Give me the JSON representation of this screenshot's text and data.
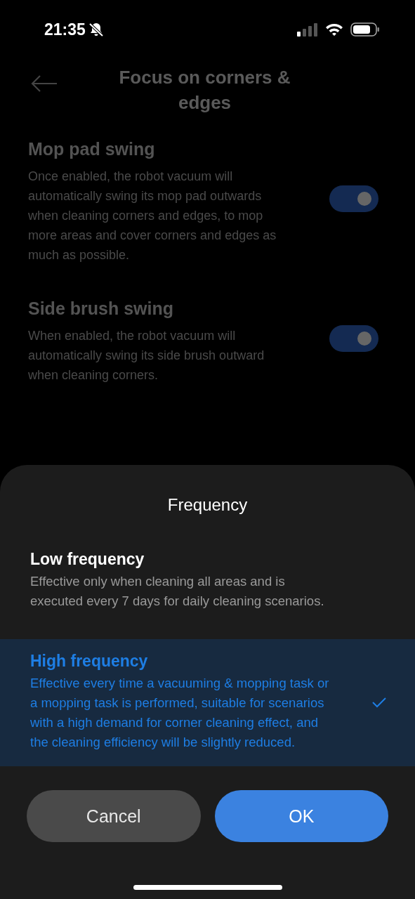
{
  "status_bar": {
    "time": "21:35"
  },
  "header": {
    "title": "Focus on corners & edges"
  },
  "settings": [
    {
      "title": "Mop pad swing",
      "description": "Once enabled, the robot vacuum will automatically swing its mop pad outwards when cleaning corners and edges, to mop more areas and cover corners and edges as much as possible.",
      "on": true
    },
    {
      "title": "Side brush swing",
      "description": "When enabled, the robot vacuum will automatically swing its side brush outward when cleaning corners.",
      "on": true
    }
  ],
  "sheet": {
    "title": "Frequency",
    "options": [
      {
        "label": "Low frequency",
        "description": "Effective only when cleaning all areas and is executed every 7 days for daily cleaning scenarios.",
        "selected": false
      },
      {
        "label": "High frequency",
        "description": "Effective every time a vacuuming & mopping task or a mopping task is performed, suitable for scenarios with a high demand for corner cleaning effect, and the cleaning efficiency will be slightly reduced.",
        "selected": true
      }
    ],
    "buttons": [
      {
        "label": "Cancel",
        "kind": "secondary"
      },
      {
        "label": "OK",
        "kind": "primary"
      }
    ]
  }
}
